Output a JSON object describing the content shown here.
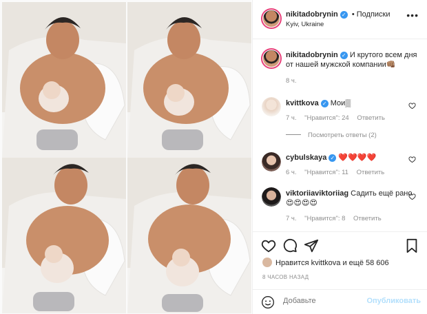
{
  "post": {
    "author": "nikitadobrynin",
    "follow_label": "• Подписки",
    "location": "Kyiv, Ukraine",
    "more_icon": "more-horizontal-icon",
    "caption_text": "И крутого всем дня от нашей мужской компании👊🏽",
    "caption_time": "8 ч."
  },
  "comments": [
    {
      "user": "kvittkova",
      "verified": true,
      "text": "Мои▒",
      "time": "7 ч.",
      "likes": "\"Нравится\": 24",
      "reply": "Ответить",
      "view_replies": "Посмотреть ответы (2)"
    },
    {
      "user": "cybulskaya",
      "verified": true,
      "text": "❤️❤️❤️❤️",
      "time": "6 ч.",
      "likes": "\"Нравится\": 11",
      "reply": "Ответить"
    },
    {
      "user": "viktoriiaviktoriiag",
      "verified": false,
      "text": "Садить ещё рано 😍😍😍😍",
      "time": "7 ч.",
      "likes": "\"Нравится\": 8",
      "reply": "Ответить"
    }
  ],
  "actions": {
    "icons": [
      "heart-icon",
      "comment-icon",
      "share-icon",
      "bookmark-icon"
    ]
  },
  "liked_by": {
    "prefix": "Нравится ",
    "user": "kvittkova",
    "suffix": " и ещё 58 606"
  },
  "posted_ago": "8 ЧАСОВ НАЗАД",
  "add_comment": {
    "placeholder": "Добавьте",
    "publish_label": "Опубликовать",
    "emoji_icon": "smiley-icon"
  },
  "colors": {
    "verified": "#3897f0",
    "muted": "#8e8e8e",
    "publish_disabled": "#b2dffc",
    "story_ring": "#e8417a"
  }
}
